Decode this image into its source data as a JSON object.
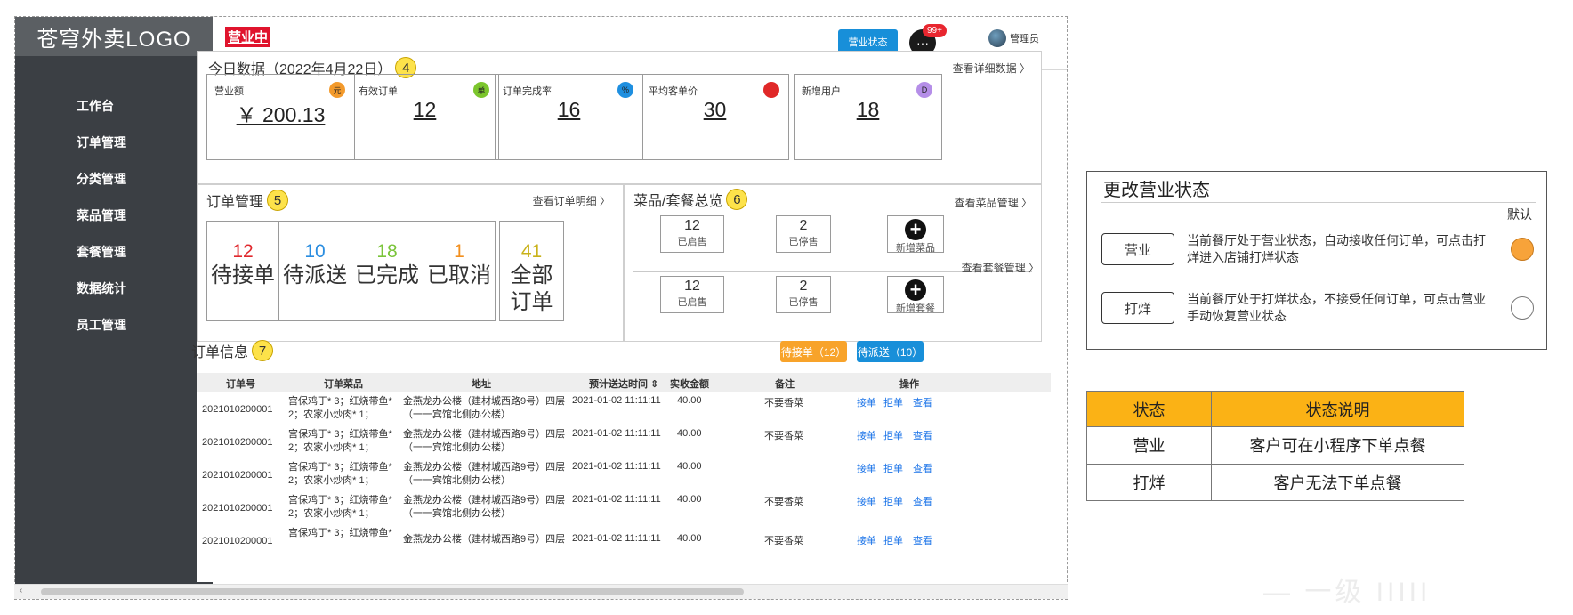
{
  "sidebar": {
    "logo": "苍穹外卖LOGO",
    "items": [
      {
        "label": "工作台"
      },
      {
        "label": "订单管理"
      },
      {
        "label": "分类管理"
      },
      {
        "label": "菜品管理"
      },
      {
        "label": "套餐管理"
      },
      {
        "label": "数据统计"
      },
      {
        "label": "员工管理"
      }
    ]
  },
  "header": {
    "status_tag": "营业中",
    "status_button": "营业状态",
    "msg_badge": "99+",
    "msg_icon": "···",
    "admin": "管理员",
    "cursor_icon": "⇔"
  },
  "today": {
    "title": "今日数据（2022年4月22日）",
    "num": "4",
    "link": "查看详细数据 〉",
    "cards": [
      {
        "label": "营业额",
        "icon": "元",
        "icon_color": "#f39a2c",
        "value": "￥ 200.13"
      },
      {
        "label": "有效订单",
        "icon": "单",
        "icon_color": "#7cc62d",
        "value": "12"
      },
      {
        "label": "订单完成率",
        "icon": "%",
        "icon_color": "#1e8fe0",
        "value": "16"
      },
      {
        "label": "平均客单价",
        "icon": "",
        "icon_color": "#e02828",
        "value": "30"
      },
      {
        "label": "新增用户",
        "icon": "D",
        "icon_color": "#b58ee8",
        "value": "18"
      }
    ]
  },
  "orders": {
    "title": "订单管理",
    "num": "5",
    "link": "查看订单明细 〉",
    "boxes": [
      {
        "num": "12",
        "color": "#e0282d",
        "label": "待接单"
      },
      {
        "num": "10",
        "color": "#2a8de0",
        "label": "待派送"
      },
      {
        "num": "18",
        "color": "#7ac43a",
        "label": "已完成"
      },
      {
        "num": "1",
        "color": "#f28f1e",
        "label": "已取消"
      },
      {
        "num": "41",
        "color": "#c9b21a",
        "label": "全部订单"
      }
    ]
  },
  "dishes": {
    "title": "菜品/套餐总览",
    "num": "6",
    "link1": "查看菜品管理 〉",
    "link2": "查看套餐管理 〉",
    "row1": [
      {
        "num": "12",
        "label": "已启售"
      },
      {
        "num": "2",
        "label": "已停售"
      },
      {
        "label": "新增菜品"
      }
    ],
    "row2": [
      {
        "num": "12",
        "label": "已启售"
      },
      {
        "num": "2",
        "label": "已停售"
      },
      {
        "label": "新增套餐"
      }
    ]
  },
  "orderinfo": {
    "title": "订单信息",
    "num": "7",
    "btn_pending": "待接单（12）",
    "btn_dispatch": "待派送（10）",
    "columns": [
      "订单号",
      "订单菜品",
      "地址",
      "预计送达时间 ⇕",
      "实收金额",
      "备注",
      "操作"
    ],
    "rows": [
      {
        "id": "2021010200001",
        "dish1": "宫保鸡丁* 3；红烧带鱼*",
        "dish2": "2；农家小炒肉* 1；",
        "addr1": "金燕龙办公楼（建材城西路9号）四层",
        "addr2": "（一一宾馆北侧办公楼）",
        "time": "2021-01-02 11:11:11",
        "amount": "40.00",
        "note": "不要香菜",
        "a1": "接单",
        "a2": "拒单",
        "a3": "查看"
      },
      {
        "id": "2021010200001",
        "dish1": "宫保鸡丁* 3；红烧带鱼*",
        "dish2": "2；农家小炒肉* 1；",
        "addr1": "金燕龙办公楼（建材城西路9号）四层",
        "addr2": "（一一宾馆北侧办公楼）",
        "time": "2021-01-02 11:11:11",
        "amount": "40.00",
        "note": "不要香菜",
        "a1": "接单",
        "a2": "拒单",
        "a3": "查看"
      },
      {
        "id": "2021010200001",
        "dish1": "宫保鸡丁* 3；红烧带鱼*",
        "dish2": "2；农家小炒肉* 1；",
        "addr1": "金燕龙办公楼（建材城西路9号）四层",
        "addr2": "（一一宾馆北侧办公楼）",
        "time": "2021-01-02 11:11:11",
        "amount": "40.00",
        "note": "",
        "a1": "接单",
        "a2": "拒单",
        "a3": "查看"
      },
      {
        "id": "2021010200001",
        "dish1": "宫保鸡丁* 3；红烧带鱼*",
        "dish2": "2；农家小炒肉* 1；",
        "addr1": "金燕龙办公楼（建材城西路9号）四层",
        "addr2": "（一一宾馆北侧办公楼）",
        "time": "2021-01-02 11:11:11",
        "amount": "40.00",
        "note": "不要香菜",
        "a1": "接单",
        "a2": "拒单",
        "a3": "查看"
      },
      {
        "id": "2021010200001",
        "dish1": "宫保鸡丁* 3；红烧带鱼*",
        "dish2": "",
        "addr1": "金燕龙办公楼（建材城西路9号）四层",
        "addr2": "",
        "time": "2021-01-02 11:11:11",
        "amount": "40.00",
        "note": "不要香菜",
        "a1": "接单",
        "a2": "拒单",
        "a3": "查看"
      }
    ]
  },
  "change_status": {
    "title": "更改营业状态",
    "default_label": "默认",
    "open": {
      "label": "营业",
      "desc": "当前餐厅处于营业状态，自动接收任何订单，可点击打烊进入店铺打烊状态",
      "selected_color": "#f7a33a"
    },
    "closed": {
      "label": "打烊",
      "desc": "当前餐厅处于打烊状态，不接受任何订单，可点击营业手动恢复营业状态"
    }
  },
  "status_table": {
    "headers": [
      "状态",
      "状态说明"
    ],
    "rows": [
      [
        "营业",
        "客户可在小程序下单点餐"
      ],
      [
        "打烊",
        "客户无法下单点餐"
      ]
    ]
  },
  "watermark": "— 一级 IIIII"
}
